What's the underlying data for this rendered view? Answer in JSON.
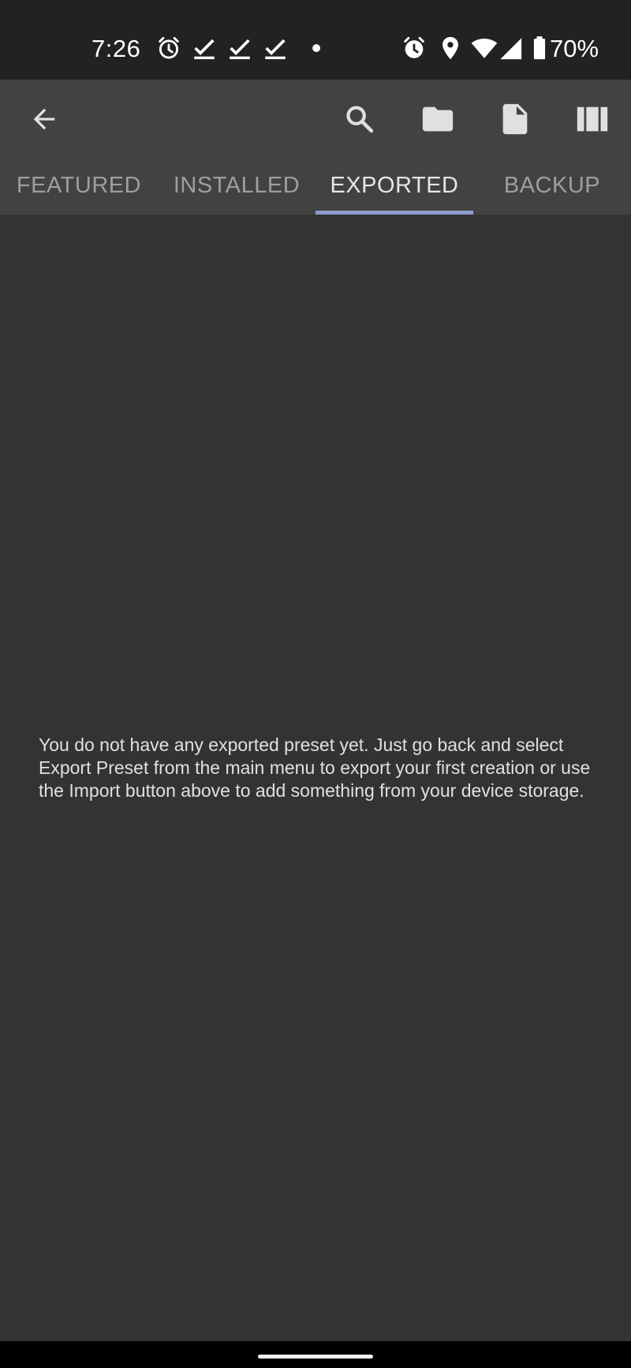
{
  "status_bar": {
    "time": "7:26",
    "battery": "70%",
    "left_icons": [
      "alarm-icon",
      "check-icon",
      "check-icon",
      "check-icon",
      "dot-icon"
    ],
    "right_icons": [
      "alarm-icon",
      "location-icon",
      "wifi-icon",
      "signal-icon",
      "battery-icon"
    ]
  },
  "toolbar": {
    "actions": [
      "back-arrow-icon",
      "search-icon",
      "folder-icon",
      "file-icon",
      "columns-icon"
    ]
  },
  "tabs": [
    {
      "label": "FEATURED",
      "active": false
    },
    {
      "label": "INSTALLED",
      "active": false
    },
    {
      "label": "EXPORTED",
      "active": true
    },
    {
      "label": "BACKUP",
      "active": false
    }
  ],
  "content": {
    "empty_message": "You do not have any exported preset yet. Just go back and select Export Preset from the main menu to export your first creation or use the Import button above to add something from your device storage."
  },
  "colors": {
    "status_bar_bg": "#222222",
    "toolbar_bg": "#424242",
    "content_bg": "#333333",
    "tab_indicator": "#8c9ccf",
    "active_tab_text": "#e6e6e6",
    "inactive_tab_text": "#9e9e9e"
  }
}
